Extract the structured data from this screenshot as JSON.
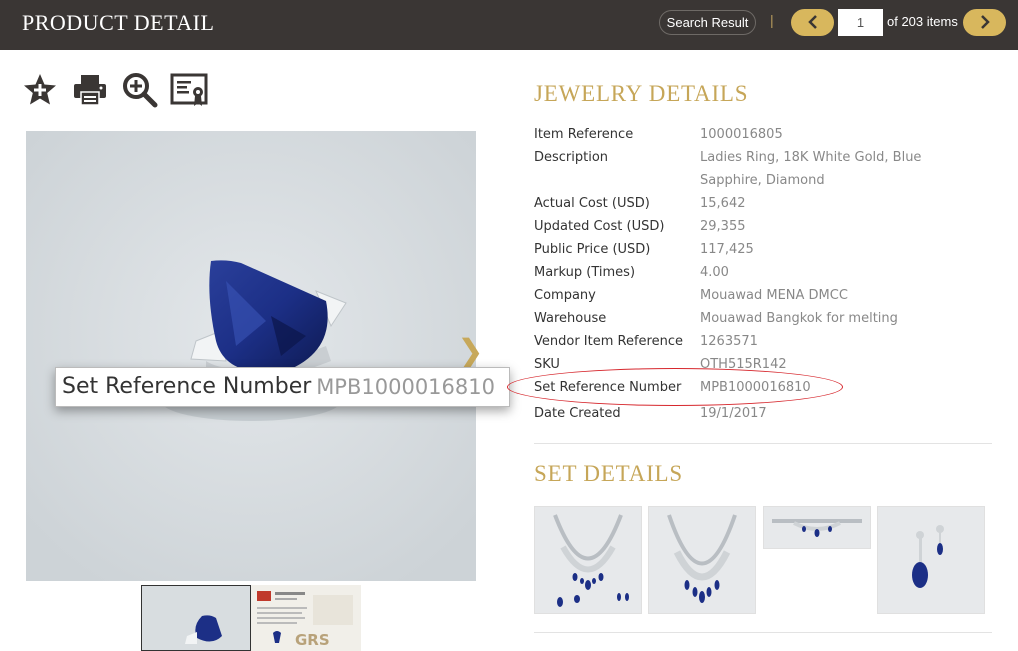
{
  "header": {
    "title": "PRODUCT DETAIL",
    "search_result_label": "Search Result",
    "separator": "|",
    "page_value": "1",
    "page_total": "of 203 items",
    "prev_icon": "chevron-left-icon",
    "next_icon": "chevron-right-icon"
  },
  "toolbar": {
    "icons": [
      "star-add-icon",
      "print-icon",
      "zoom-in-icon",
      "certificate-icon"
    ]
  },
  "gallery": {
    "next_arrow": "❯",
    "zoom_label": "Set Reference Number",
    "zoom_value": "MPB1000016810",
    "thumbnail_text": "GRS"
  },
  "jewelry_details": {
    "title": "JEWELRY DETAILS",
    "rows": [
      {
        "label": "Item Reference",
        "value": "1000016805"
      },
      {
        "label": "Description",
        "value": "Ladies Ring, 18K White Gold, Blue Sapphire, Diamond"
      },
      {
        "label": "Actual Cost (USD)",
        "value": "15,642"
      },
      {
        "label": "Updated Cost (USD)",
        "value": "29,355"
      },
      {
        "label": "Public Price (USD)",
        "value": "117,425"
      },
      {
        "label": "Markup (Times)",
        "value": "4.00"
      },
      {
        "label": "Company",
        "value": "Mouawad MENA DMCC"
      },
      {
        "label": "Warehouse",
        "value": "Mouawad Bangkok for melting"
      },
      {
        "label": "Vendor Item Reference",
        "value": "1263571"
      },
      {
        "label": "SKU",
        "value": "OTH515R142"
      },
      {
        "label": "Set Reference Number",
        "value": "MPB1000016810"
      },
      {
        "label": "Date Created",
        "value": "19/1/2017"
      }
    ]
  },
  "set_details": {
    "title": "SET DETAILS"
  },
  "colors": {
    "header_bg": "#3a3634",
    "accent_gold": "#c6a658",
    "button_gold": "#d8b75d",
    "highlight_red": "#d6262c"
  }
}
